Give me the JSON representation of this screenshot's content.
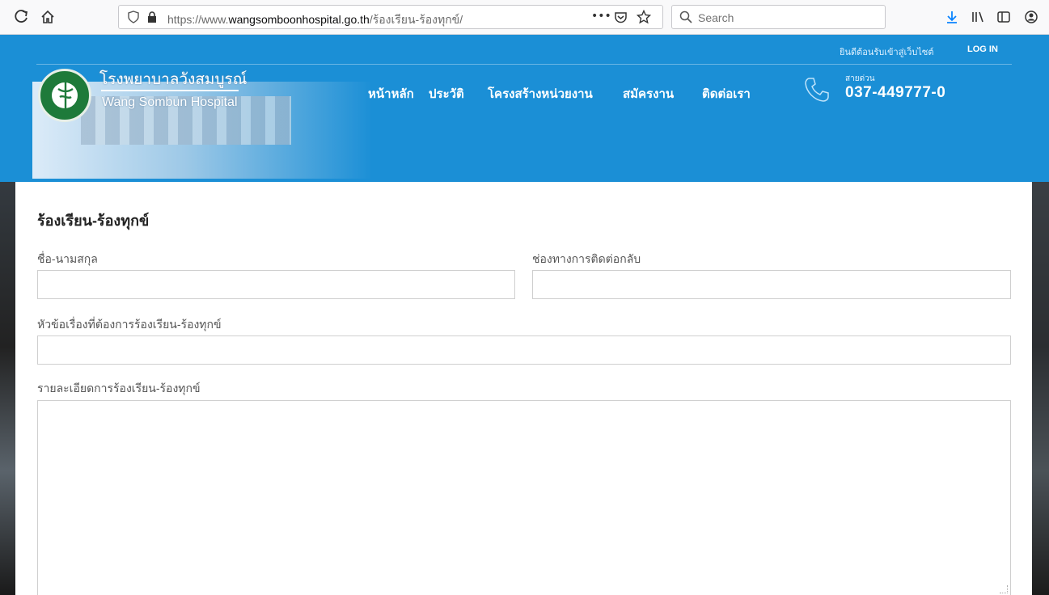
{
  "browser": {
    "url_prefix": "https://www.",
    "url_domain": "wangsomboonhospital.go.th",
    "url_path": "/ร้องเรียน-ร้องทุกข์/",
    "search_placeholder": "Search",
    "more_label": "•••"
  },
  "header": {
    "welcome": "ยินดีต้อนรับเข้าสู่เว็บไซต์",
    "login": "LOG IN",
    "hospital_name_th": "โรงพยาบาลวังสมบูรณ์",
    "hospital_name_en": "Wang Sombun Hospital",
    "nav": [
      "หน้าหลัก",
      "ประวัติ",
      "โครงสร้างหน่วยงาน",
      "สมัครงาน",
      "ติดต่อเรา"
    ],
    "hotline_label": "สายด่วน",
    "hotline": "037-449777-0"
  },
  "form": {
    "title": "ร้องเรียน-ร้องทุกข์",
    "name_label": "ชื่อ-นามสกุล",
    "contact_label": "ช่องทางการติดต่อกลับ",
    "subject_label": "หัวข้อเรื่องที่ต้องการร้องเรียน-ร้องทุกข์",
    "detail_label": "รายละเอียดการร้องเรียน-ร้องทุกข์",
    "name_value": "",
    "contact_value": "",
    "subject_value": "",
    "detail_value": ""
  }
}
